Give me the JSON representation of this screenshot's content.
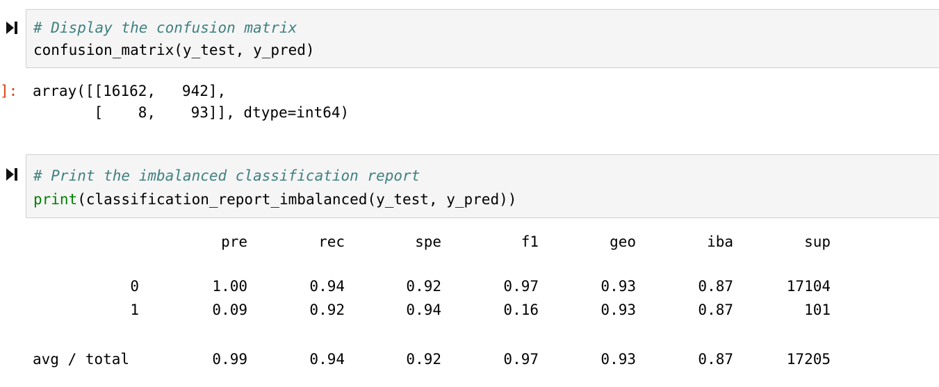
{
  "cell1": {
    "comment": "# Display the confusion matrix",
    "code": "confusion_matrix(y_test, y_pred)"
  },
  "output1": {
    "prompt": "]:",
    "line1": "array([[16162,   942],",
    "line2": "       [    8,    93]], dtype=int64)"
  },
  "cell2": {
    "comment": "# Print the imbalanced classification report",
    "code_builtin": "print",
    "code_rest": "(classification_report_imbalanced(y_test, y_pred))"
  },
  "report": {
    "headers": [
      "pre",
      "rec",
      "spe",
      "f1",
      "geo",
      "iba",
      "sup"
    ],
    "rows": [
      {
        "label": "0",
        "values": [
          "1.00",
          "0.94",
          "0.92",
          "0.97",
          "0.93",
          "0.87",
          "17104"
        ]
      },
      {
        "label": "1",
        "values": [
          "0.09",
          "0.92",
          "0.94",
          "0.16",
          "0.93",
          "0.87",
          "101"
        ]
      }
    ],
    "total": {
      "label": "avg / total",
      "values": [
        "0.99",
        "0.94",
        "0.92",
        "0.97",
        "0.93",
        "0.87",
        "17205"
      ]
    }
  },
  "icons": {
    "run": "run-cell-icon"
  }
}
